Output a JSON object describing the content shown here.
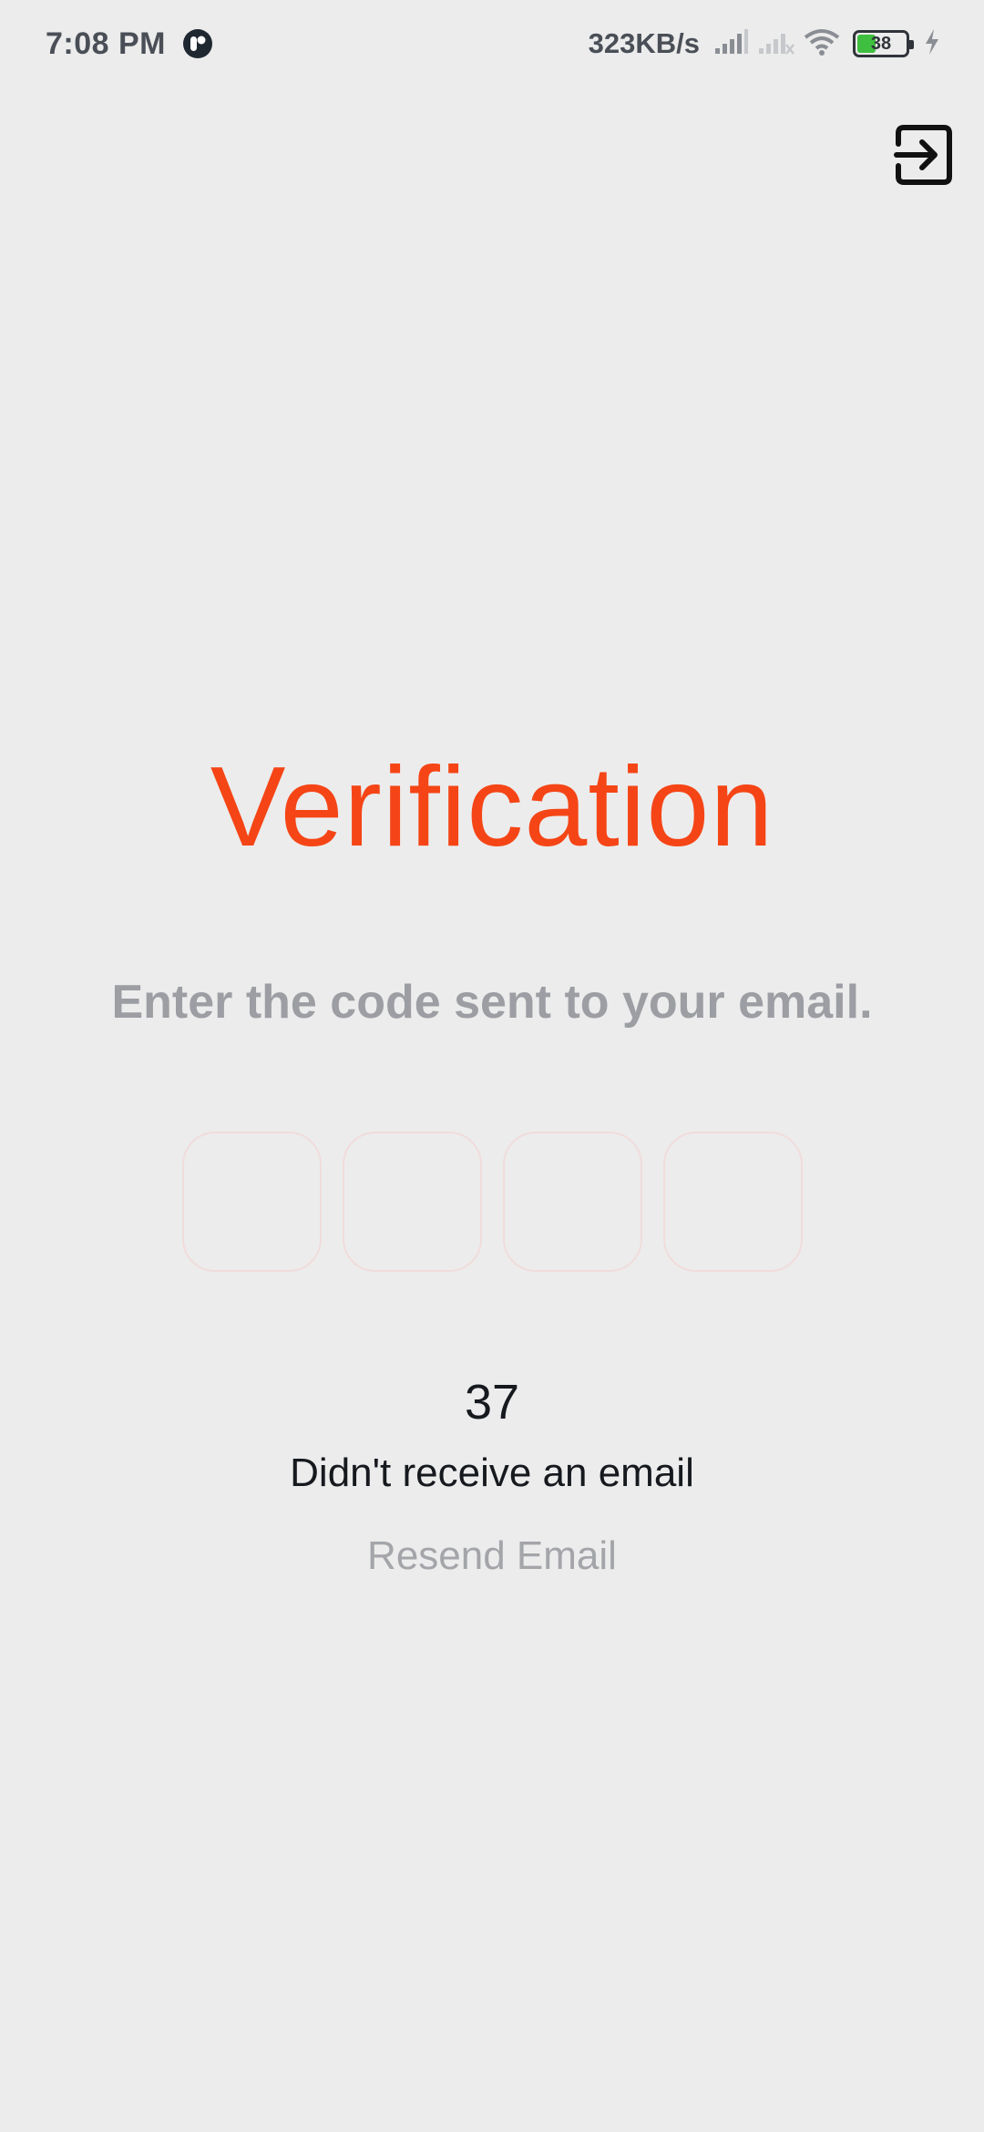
{
  "status_bar": {
    "time": "7:08 PM",
    "network_speed": "323KB/s",
    "battery_level": "38",
    "battery_percent": 38,
    "icons": [
      "app-notification-icon",
      "signal-icon",
      "signal-no-sim-icon",
      "wifi-icon",
      "battery-icon",
      "charging-icon"
    ]
  },
  "header": {
    "logout_icon": "exit-to-app-icon"
  },
  "main": {
    "title": "Verification",
    "subtitle": "Enter the code sent to your email.",
    "code_digits": [
      "",
      "",
      "",
      ""
    ],
    "timer": "37",
    "no_email_text": "Didn't receive an email",
    "resend_label": "Resend Email"
  },
  "colors": {
    "background": "#ececec",
    "accent": "#f54516",
    "muted_text": "#9c9ea3",
    "dark_text": "#16191e",
    "code_box_border": "#f1dcdc",
    "battery_fill": "#3fbf3f"
  }
}
